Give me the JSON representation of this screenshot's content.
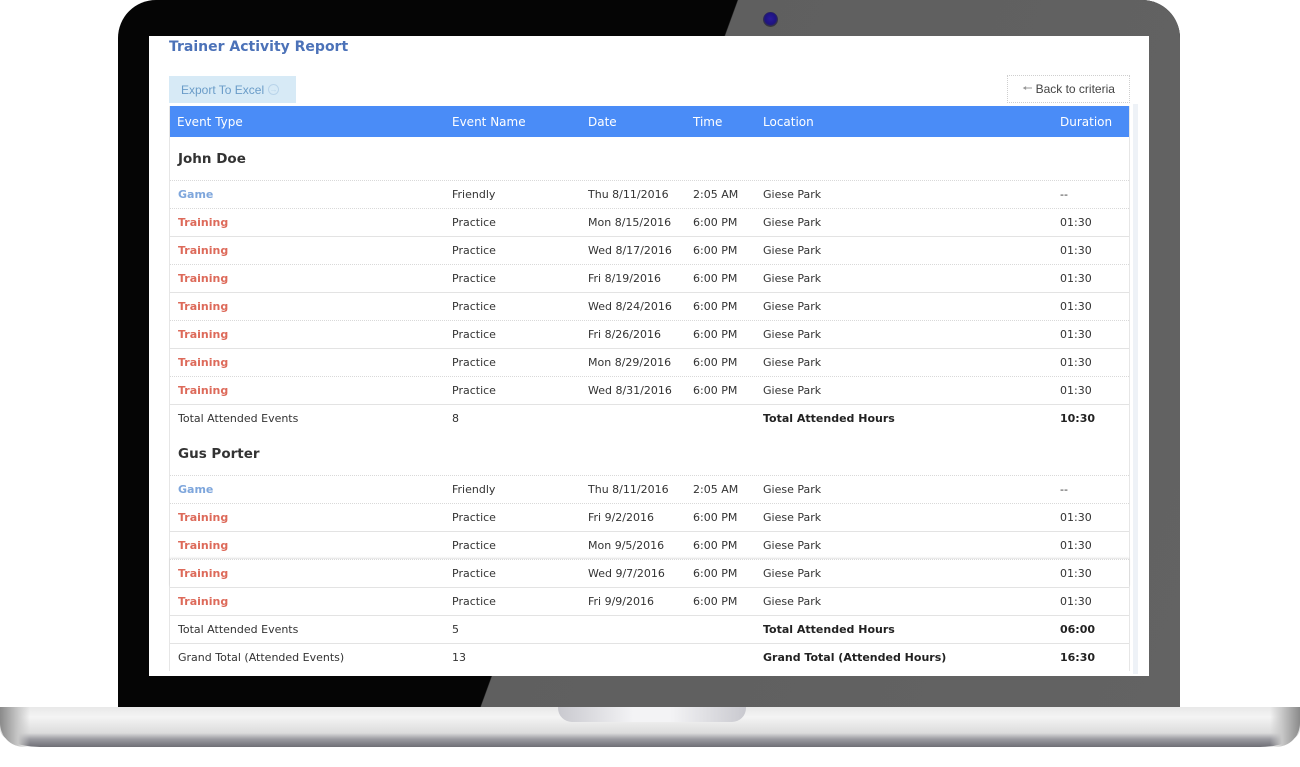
{
  "report": {
    "title": "Trainer Activity Report",
    "export_label": "Export To Excel",
    "back_label": "Back to criteria",
    "columns": [
      "Event Type",
      "Event Name",
      "Date",
      "Time",
      "Location",
      "Duration"
    ],
    "groups": [
      {
        "name": "John Doe",
        "rows": [
          {
            "type": "Game",
            "name": "Friendly",
            "date": "Thu 8/11/2016",
            "time": "2:05 AM",
            "location": "Giese Park",
            "duration": "--"
          },
          {
            "type": "Training",
            "name": "Practice",
            "date": "Mon 8/15/2016",
            "time": "6:00 PM",
            "location": "Giese Park",
            "duration": "01:30"
          },
          {
            "type": "Training",
            "name": "Practice",
            "date": "Wed 8/17/2016",
            "time": "6:00 PM",
            "location": "Giese Park",
            "duration": "01:30"
          },
          {
            "type": "Training",
            "name": "Practice",
            "date": "Fri 8/19/2016",
            "time": "6:00 PM",
            "location": "Giese Park",
            "duration": "01:30"
          },
          {
            "type": "Training",
            "name": "Practice",
            "date": "Wed 8/24/2016",
            "time": "6:00 PM",
            "location": "Giese Park",
            "duration": "01:30"
          },
          {
            "type": "Training",
            "name": "Practice",
            "date": "Fri 8/26/2016",
            "time": "6:00 PM",
            "location": "Giese Park",
            "duration": "01:30"
          },
          {
            "type": "Training",
            "name": "Practice",
            "date": "Mon 8/29/2016",
            "time": "6:00 PM",
            "location": "Giese Park",
            "duration": "01:30"
          },
          {
            "type": "Training",
            "name": "Practice",
            "date": "Wed 8/31/2016",
            "time": "6:00 PM",
            "location": "Giese Park",
            "duration": "01:30"
          }
        ],
        "total_events_label": "Total Attended Events",
        "total_events": "8",
        "total_hours_label": "Total Attended Hours",
        "total_hours": "10:30"
      },
      {
        "name": "Gus Porter",
        "rows": [
          {
            "type": "Game",
            "name": "Friendly",
            "date": "Thu 8/11/2016",
            "time": "2:05 AM",
            "location": "Giese Park",
            "duration": "--"
          },
          {
            "type": "Training",
            "name": "Practice",
            "date": "Fri 9/2/2016",
            "time": "6:00 PM",
            "location": "Giese Park",
            "duration": "01:30"
          },
          {
            "type": "Training",
            "name": "Practice",
            "date": "Mon 9/5/2016",
            "time": "6:00 PM",
            "location": "Giese Park",
            "duration": "01:30"
          },
          {
            "type": "Training",
            "name": "Practice",
            "date": "Wed 9/7/2016",
            "time": "6:00 PM",
            "location": "Giese Park",
            "duration": "01:30"
          },
          {
            "type": "Training",
            "name": "Practice",
            "date": "Fri 9/9/2016",
            "time": "6:00 PM",
            "location": "Giese Park",
            "duration": "01:30"
          }
        ],
        "total_events_label": "Total Attended Events",
        "total_events": "5",
        "total_hours_label": "Total Attended Hours",
        "total_hours": "06:00"
      }
    ],
    "grand_total": {
      "events_label": "Grand Total (Attended Events)",
      "events": "13",
      "hours_label": "Grand Total (Attended Hours)",
      "hours": "16:30"
    }
  },
  "icons": {
    "export": "arrow-circle-right-icon",
    "back": "arrow-left-icon"
  },
  "colors": {
    "header_bg": "#4a8cf7",
    "title": "#4c72b8",
    "game": "#7ea6dc",
    "training": "#dd6a5a",
    "export_bg": "#d7eaf6"
  }
}
